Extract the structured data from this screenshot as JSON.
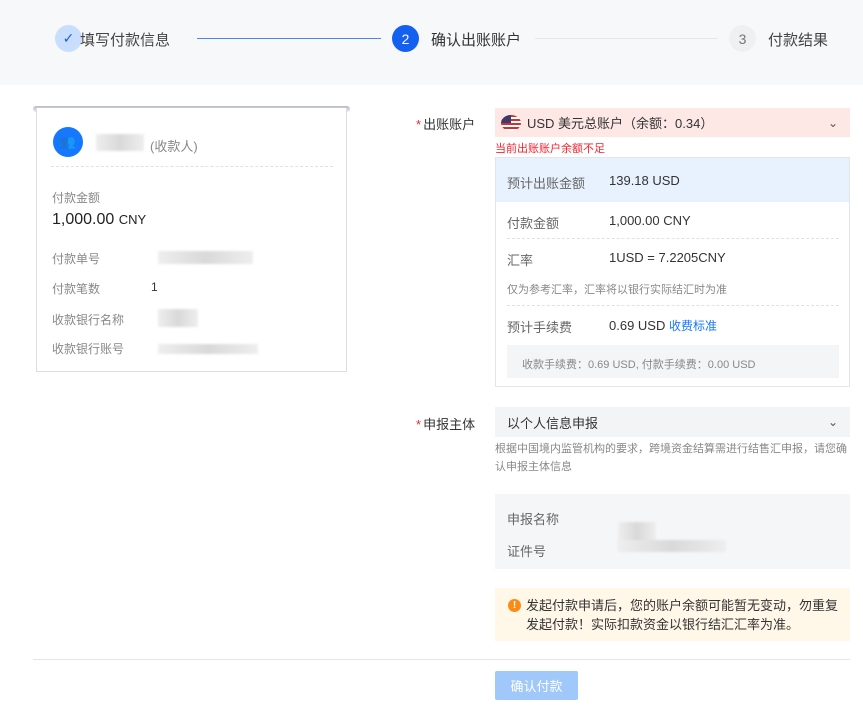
{
  "steps": [
    {
      "label": "填写付款信息",
      "status": "done"
    },
    {
      "number": "2",
      "label": "确认出账账户",
      "status": "active"
    },
    {
      "number": "3",
      "label": "付款结果",
      "status": "pending"
    }
  ],
  "payee": {
    "role": "(收款人)",
    "amount_label": "付款金额",
    "amount": "1,000.00",
    "currency": "CNY",
    "order_no_label": "付款单号",
    "count_label": "付款笔数",
    "count": "1",
    "bank_name_label": "收款银行名称",
    "bank_account_label": "收款银行账号"
  },
  "account": {
    "label": "出账账户",
    "selected": "USD 美元总账户（余额：0.34）",
    "error": "当前出账账户余额不足"
  },
  "summary": {
    "est_label": "预计出账金额",
    "est_value": "139.18 USD",
    "pay_label": "付款金额",
    "pay_value": "1,000.00 CNY",
    "rate_label": "汇率",
    "rate_value": "1USD = 7.2205CNY",
    "rate_note": "仅为参考汇率，汇率将以银行实际结汇时为准",
    "fee_label": "预计手续费",
    "fee_value": "0.69 USD",
    "fee_link": "收费标准",
    "fee_detail": "收款手续费：0.69 USD, 付款手续费：0.00 USD"
  },
  "declare": {
    "label": "申报主体",
    "selected": "以个人信息申报",
    "hint": "根据中国境内监管机构的要求，跨境资金结算需进行结售汇申报，请您确认申报主体信息",
    "name_label": "申报名称",
    "id_label": "证件号"
  },
  "warning": "发起付款申请后，您的账户余额可能暂无变动，勿重复发起付款！实际扣款资金以银行结汇汇率为准。",
  "confirm_button": "确认付款",
  "colors": {
    "primary": "#1460f0",
    "error": "#f5222d",
    "warning": "#fa8c16"
  }
}
